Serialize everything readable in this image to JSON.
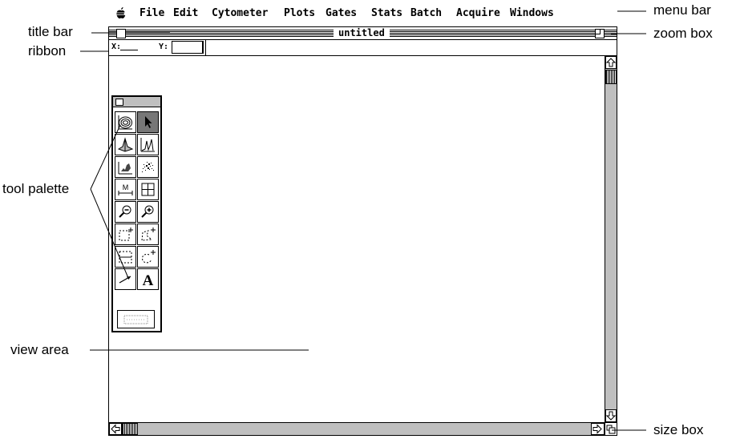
{
  "menubar": {
    "items": [
      "File",
      "Edit",
      "Cytometer",
      "Plots",
      "Gates",
      "Stats",
      "Batch",
      "Acquire",
      "Windows"
    ]
  },
  "window": {
    "title": "untitled"
  },
  "ribbon": {
    "x_label": "X:",
    "y_label": "Y:"
  },
  "palette": {
    "tools": [
      {
        "icon": "contour-plot-icon"
      },
      {
        "icon": "arrow-pointer-icon",
        "selected": true
      },
      {
        "icon": "3d-plot-icon"
      },
      {
        "icon": "histogram-icon"
      },
      {
        "icon": "density-plot-icon"
      },
      {
        "icon": "dot-plot-icon"
      },
      {
        "icon": "marker-icon"
      },
      {
        "icon": "quadrant-icon"
      },
      {
        "icon": "zoom-out-icon"
      },
      {
        "icon": "zoom-in-icon"
      },
      {
        "icon": "rectangle-gate-icon"
      },
      {
        "icon": "polygon-gate-icon"
      },
      {
        "icon": "range-gate-icon"
      },
      {
        "icon": "freeform-gate-icon"
      },
      {
        "icon": "line-tool-icon"
      },
      {
        "icon": "text-tool-icon"
      }
    ],
    "text_tool_glyph": "A",
    "marker_glyph": "M"
  },
  "annotations": {
    "menu_bar": "menu bar",
    "title_bar": "title bar",
    "zoom_box": "zoom box",
    "ribbon": "ribbon",
    "tool_palette": "tool palette",
    "view_area": "view area",
    "size_box": "size box"
  }
}
